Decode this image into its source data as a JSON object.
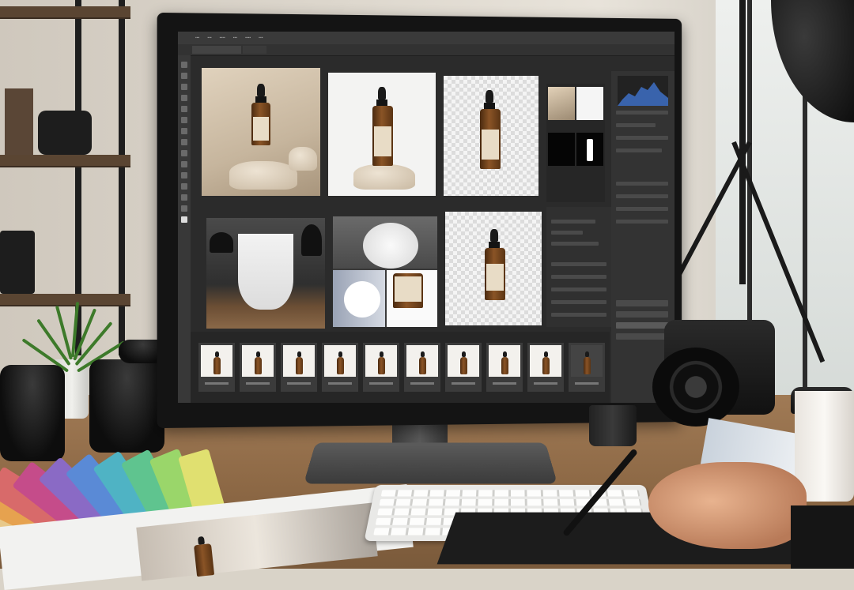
{
  "scene": {
    "subject": "photo-editing-workstation",
    "colors": {
      "wall": "#ddd7cd",
      "desk_wood": "#8a6643",
      "monitor_bezel": "#141414",
      "app_ui": "#2b2b2b",
      "amber_bottle": "#8a5426",
      "bottle_label": "#e8dcc6",
      "plant_green": "#3d7a2a"
    }
  },
  "screen": {
    "app_ui": "dark-photo-editor",
    "icons": {
      "toolbar": "tool-icon",
      "histogram": "histogram-icon"
    }
  },
  "filmstrip": {
    "thumb_count": 10
  },
  "swatches": {
    "colors": [
      "#e8c98a",
      "#e6a24f",
      "#d86a6a",
      "#c54c8a",
      "#8a6ac5",
      "#5a8ad6",
      "#4fb3c4",
      "#5fc48f",
      "#9ad66a",
      "#e0e070"
    ]
  }
}
